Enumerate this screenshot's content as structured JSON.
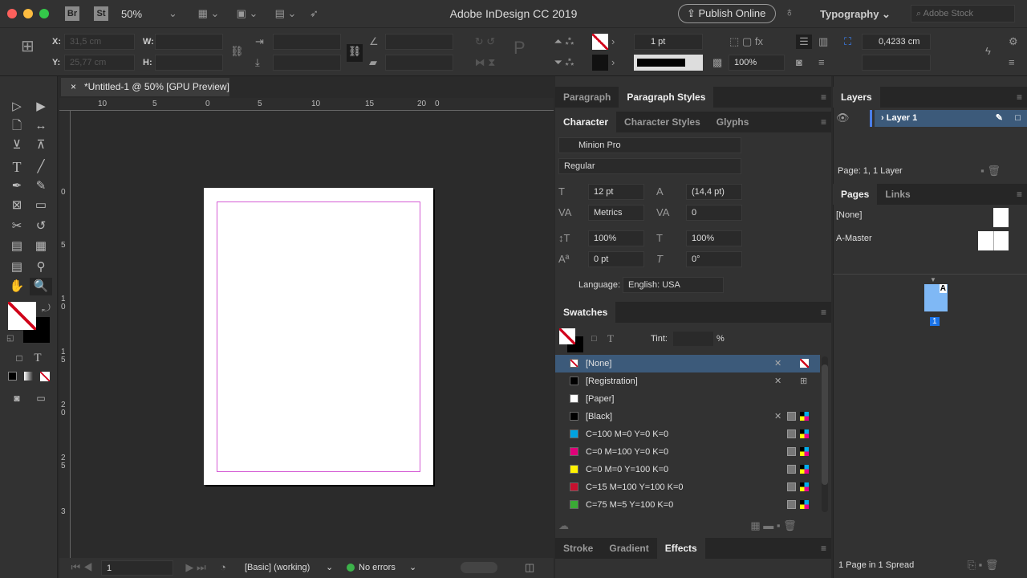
{
  "titlebar": {
    "bridge": "Br",
    "stock": "St",
    "zoom": "50%",
    "app_title": "Adobe InDesign CC 2019",
    "publish": "Publish Online",
    "workspace": "Typography",
    "search_placeholder": "Adobe Stock"
  },
  "control": {
    "x_label": "X:",
    "y_label": "Y:",
    "w_label": "W:",
    "h_label": "H:",
    "x_value": "31,5 cm",
    "y_value": "25,77 cm",
    "stroke_weight": "1 pt",
    "opacity": "100%",
    "offset_value": "0,4233 cm"
  },
  "document": {
    "tab_title": "*Untitled-1 @ 50% [GPU Preview]",
    "h_ruler": [
      "10",
      "5",
      "0",
      "5",
      "10",
      "15",
      "20",
      "0"
    ],
    "v_ruler": [
      "0",
      "5",
      "1 0",
      "1 5",
      "2 0",
      "2 5",
      "3"
    ]
  },
  "status": {
    "page": "1",
    "preflight_profile": "[Basic] (working)",
    "errors": "No errors"
  },
  "paragraph_panel": {
    "tabs": [
      "Paragraph",
      "Paragraph Styles"
    ]
  },
  "character_panel": {
    "tabs": [
      "Character",
      "Character Styles",
      "Glyphs"
    ],
    "font": "Minion Pro",
    "style": "Regular",
    "size": "12 pt",
    "leading": "(14,4 pt)",
    "kerning": "Metrics",
    "tracking": "0",
    "vscale": "100%",
    "hscale": "100%",
    "baseline": "0 pt",
    "skew": "0°",
    "language_label": "Language:",
    "language": "English: USA"
  },
  "swatches": {
    "title": "Swatches",
    "tint_label": "Tint:",
    "tint_unit": "%",
    "items": [
      {
        "name": "[None]",
        "color": "none"
      },
      {
        "name": "[Registration]",
        "color": "#000000"
      },
      {
        "name": "[Paper]",
        "color": "#ffffff"
      },
      {
        "name": "[Black]",
        "color": "#000000"
      },
      {
        "name": "C=100 M=0 Y=0 K=0",
        "color": "#00a3e0"
      },
      {
        "name": "C=0 M=100 Y=0 K=0",
        "color": "#e0007a"
      },
      {
        "name": "C=0 M=0 Y=100 K=0",
        "color": "#fff200"
      },
      {
        "name": "C=15 M=100 Y=100 K=0",
        "color": "#c8102e"
      },
      {
        "name": "C=75 M=5 Y=100 K=0",
        "color": "#3aaa35"
      }
    ]
  },
  "bottom_tabs": [
    "Stroke",
    "Gradient",
    "Effects"
  ],
  "layers": {
    "title": "Layers",
    "layer": "Layer 1",
    "footer": "Page: 1, 1 Layer"
  },
  "pages": {
    "tabs": [
      "Pages",
      "Links"
    ],
    "none": "[None]",
    "master": "A-Master",
    "master_letter": "A",
    "page_number": "1",
    "footer": "1 Page in 1 Spread"
  }
}
